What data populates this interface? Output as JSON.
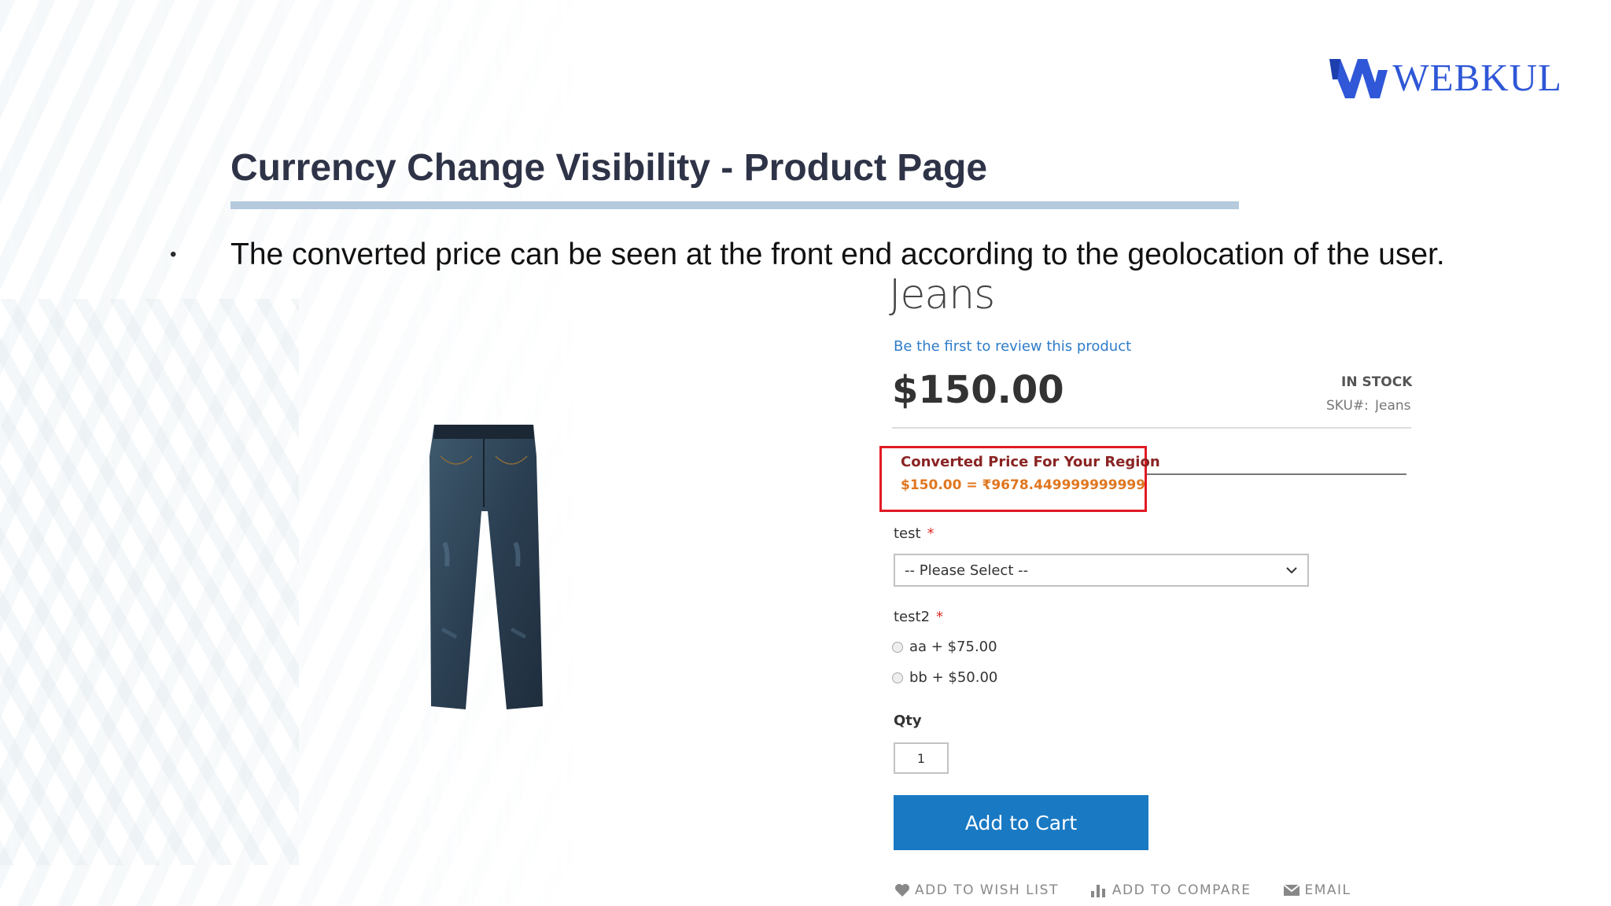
{
  "logo": {
    "text": "WEBKUL",
    "color": "#2f57d7"
  },
  "slide": {
    "title": "Currency Change Visibility - Product Page",
    "bullet": "The converted price can be seen at the front end according to the geolocation of the user."
  },
  "product": {
    "name": "Jeans",
    "review_link": "Be the first to review this product",
    "price": "$150.00",
    "stock": "IN STOCK",
    "sku_label": "SKU#:",
    "sku_value": "Jeans",
    "converted_label": "Converted Price For Your Region",
    "converted_value": "$150.00 = ₹9678.449999999999",
    "options": {
      "test": {
        "label": "test",
        "required": "*",
        "select_value": "-- Please Select --"
      },
      "test2": {
        "label": "test2",
        "required": "*",
        "radios": [
          {
            "label": "aa + $75.00"
          },
          {
            "label": "bb + $50.00"
          }
        ]
      }
    },
    "qty_label": "Qty",
    "qty_value": "1",
    "add_to_cart": "Add to Cart",
    "actions": {
      "wishlist": "ADD TO WISH LIST",
      "compare": "ADD TO COMPARE",
      "email": "EMAIL"
    }
  },
  "colors": {
    "title": "#2e3347",
    "underline": "#b5cadc",
    "highlight_border": "#e11a24",
    "converted_value": "#e0761f",
    "button": "#1979c3"
  }
}
